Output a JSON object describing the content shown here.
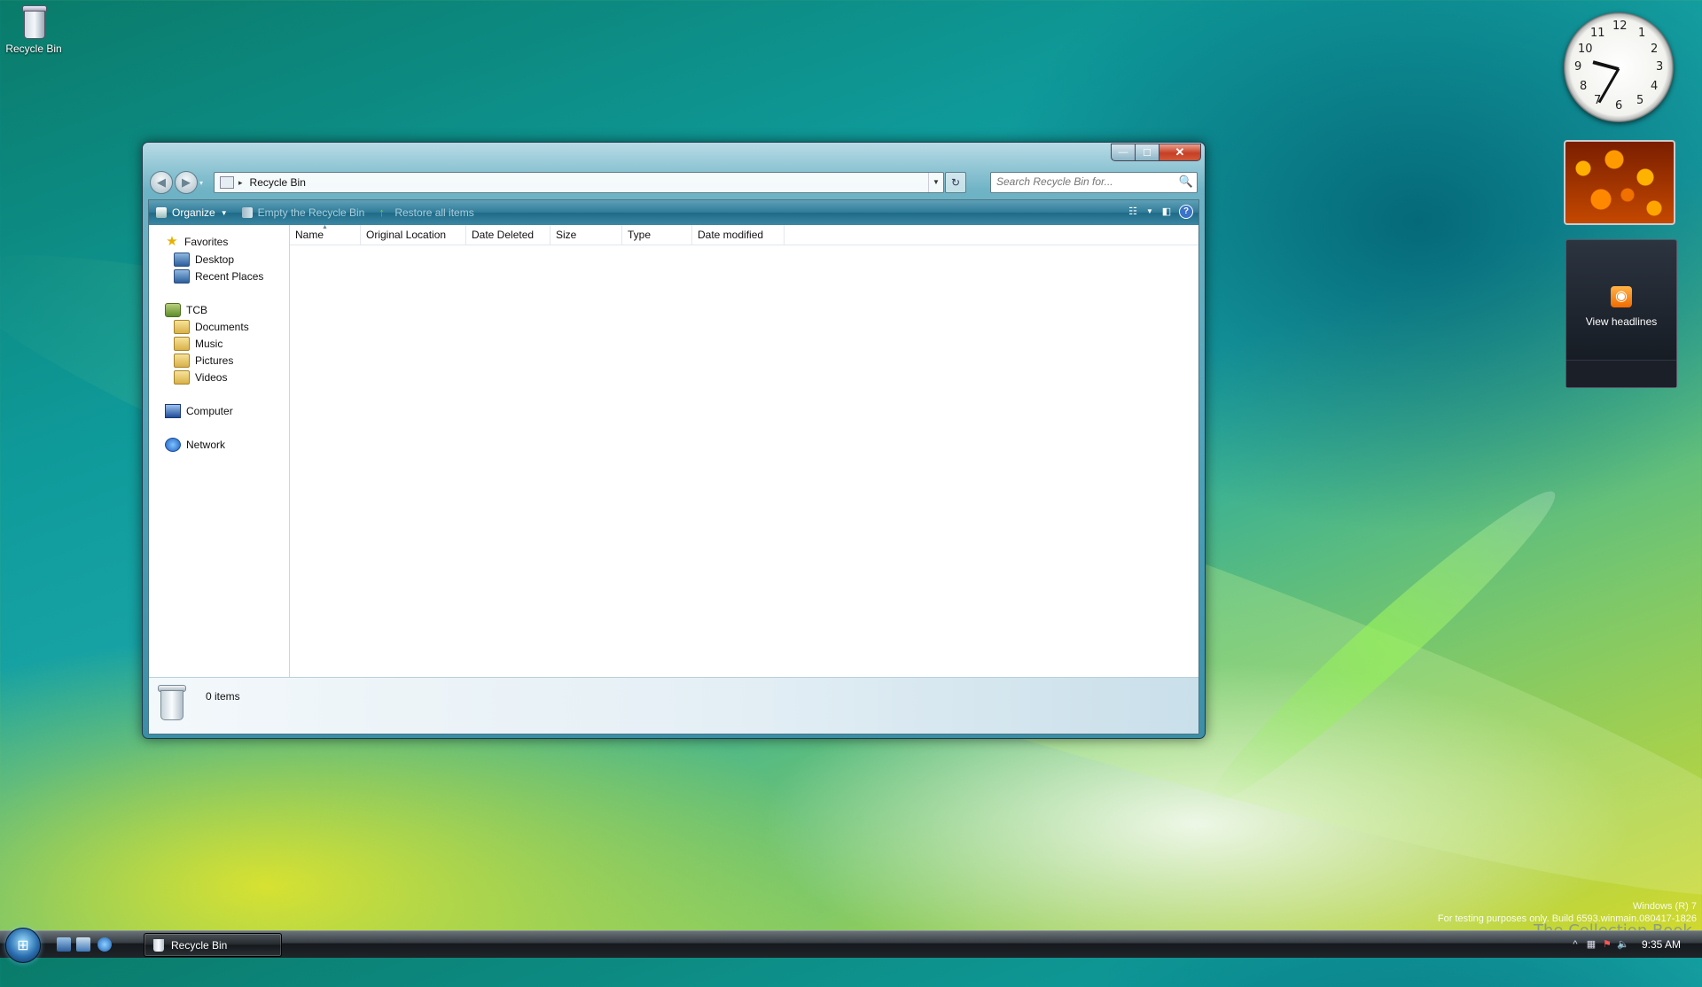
{
  "desktop": {
    "icons": [
      {
        "label": "Recycle Bin",
        "icon": "recycle-bin-icon"
      }
    ]
  },
  "gadgets": {
    "clock": {
      "numbers": [
        "12",
        "1",
        "2",
        "3",
        "4",
        "5",
        "6",
        "7",
        "8",
        "9",
        "10",
        "11"
      ],
      "time_shown": "9:35"
    },
    "slideshow": {
      "subject": "orange flowers"
    },
    "feed": {
      "label": "View headlines",
      "icon": "rss-icon"
    }
  },
  "window": {
    "title": "Recycle Bin",
    "caption_buttons": {
      "minimize": "—",
      "maximize": "☐",
      "close": "✕"
    },
    "nav": {
      "back": "◀",
      "forward": "▶",
      "recent": "▾"
    },
    "address": {
      "separator": "▸",
      "path": "Recycle Bin",
      "dropdown": "▼",
      "refresh": "↻"
    },
    "search": {
      "placeholder": "Search Recycle Bin for...",
      "icon": "🔍"
    },
    "toolbar": {
      "organize": "Organize",
      "organize_arrow": "▼",
      "empty_bin": "Empty the Recycle Bin",
      "restore_all": "Restore all items",
      "views_arrow": "▼",
      "help": "?"
    },
    "nav_pane": {
      "favorites": "Favorites",
      "desktop": "Desktop",
      "recent_places": "Recent Places",
      "user": "TCB",
      "documents": "Documents",
      "music": "Music",
      "pictures": "Pictures",
      "videos": "Videos",
      "computer": "Computer",
      "network": "Network"
    },
    "columns": [
      "Name",
      "Original Location",
      "Date Deleted",
      "Size",
      "Type",
      "Date modified"
    ],
    "sort_indicator": "▲",
    "details_pane": {
      "item_count": "0 items"
    }
  },
  "taskbar": {
    "task_button": "Recycle Bin",
    "time": "9:35 AM",
    "tray_chevron": "^"
  },
  "watermark": {
    "line1": "Windows (R) 7",
    "line2": "For testing purposes only. Build 6593.winmain.080417-1826",
    "brand": "The Collection Book"
  },
  "colors": {
    "window_frame": "#4aa0b7",
    "command_bar": "#2e7b98",
    "close_button": "#c63f24",
    "taskbar": "#1f2428"
  }
}
